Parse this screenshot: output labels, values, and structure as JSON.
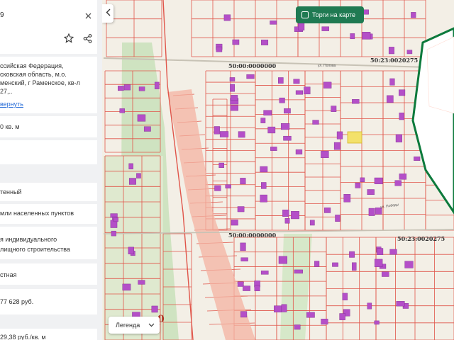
{
  "panel": {
    "header_fragment": "9",
    "address_lines": [
      "ссийская Федерация,",
      "сковская область, м.о.",
      "менский, г Раменское, кв-л",
      "27,.."
    ],
    "expand_link": "вернуть",
    "area": "0 кв. м",
    "status": "тенный",
    "category": "мли населенных пунктов",
    "use_lines": [
      "я индивидуального",
      "лищного строительства"
    ],
    "ownership": "стная",
    "cadastral_value": "77 628 руб.",
    "value_per_sqm": "29,38 руб./кв. м"
  },
  "icons": {
    "close": "close-icon",
    "favorite": "star-icon",
    "share": "share-icon",
    "collapse": "chevron-left-icon",
    "legend": "chevron-down-icon"
  },
  "map": {
    "torgi_label": "Торги на карте",
    "legend_label": "Легенда",
    "corner_digit": "0",
    "edge_digit": "9",
    "labels": [
      "50:00:0000000",
      "50:23:0020275",
      "50:00:0000000",
      "50:23:0020275"
    ],
    "streets": [
      "ул. Попова",
      "ул. Победы"
    ],
    "colors": {
      "parcel_line": "#e0554a",
      "building": "#b44fc8",
      "selected": "#f3e16a",
      "green_zone": "#0d7a3c",
      "strip": "#f4b3a2"
    }
  }
}
